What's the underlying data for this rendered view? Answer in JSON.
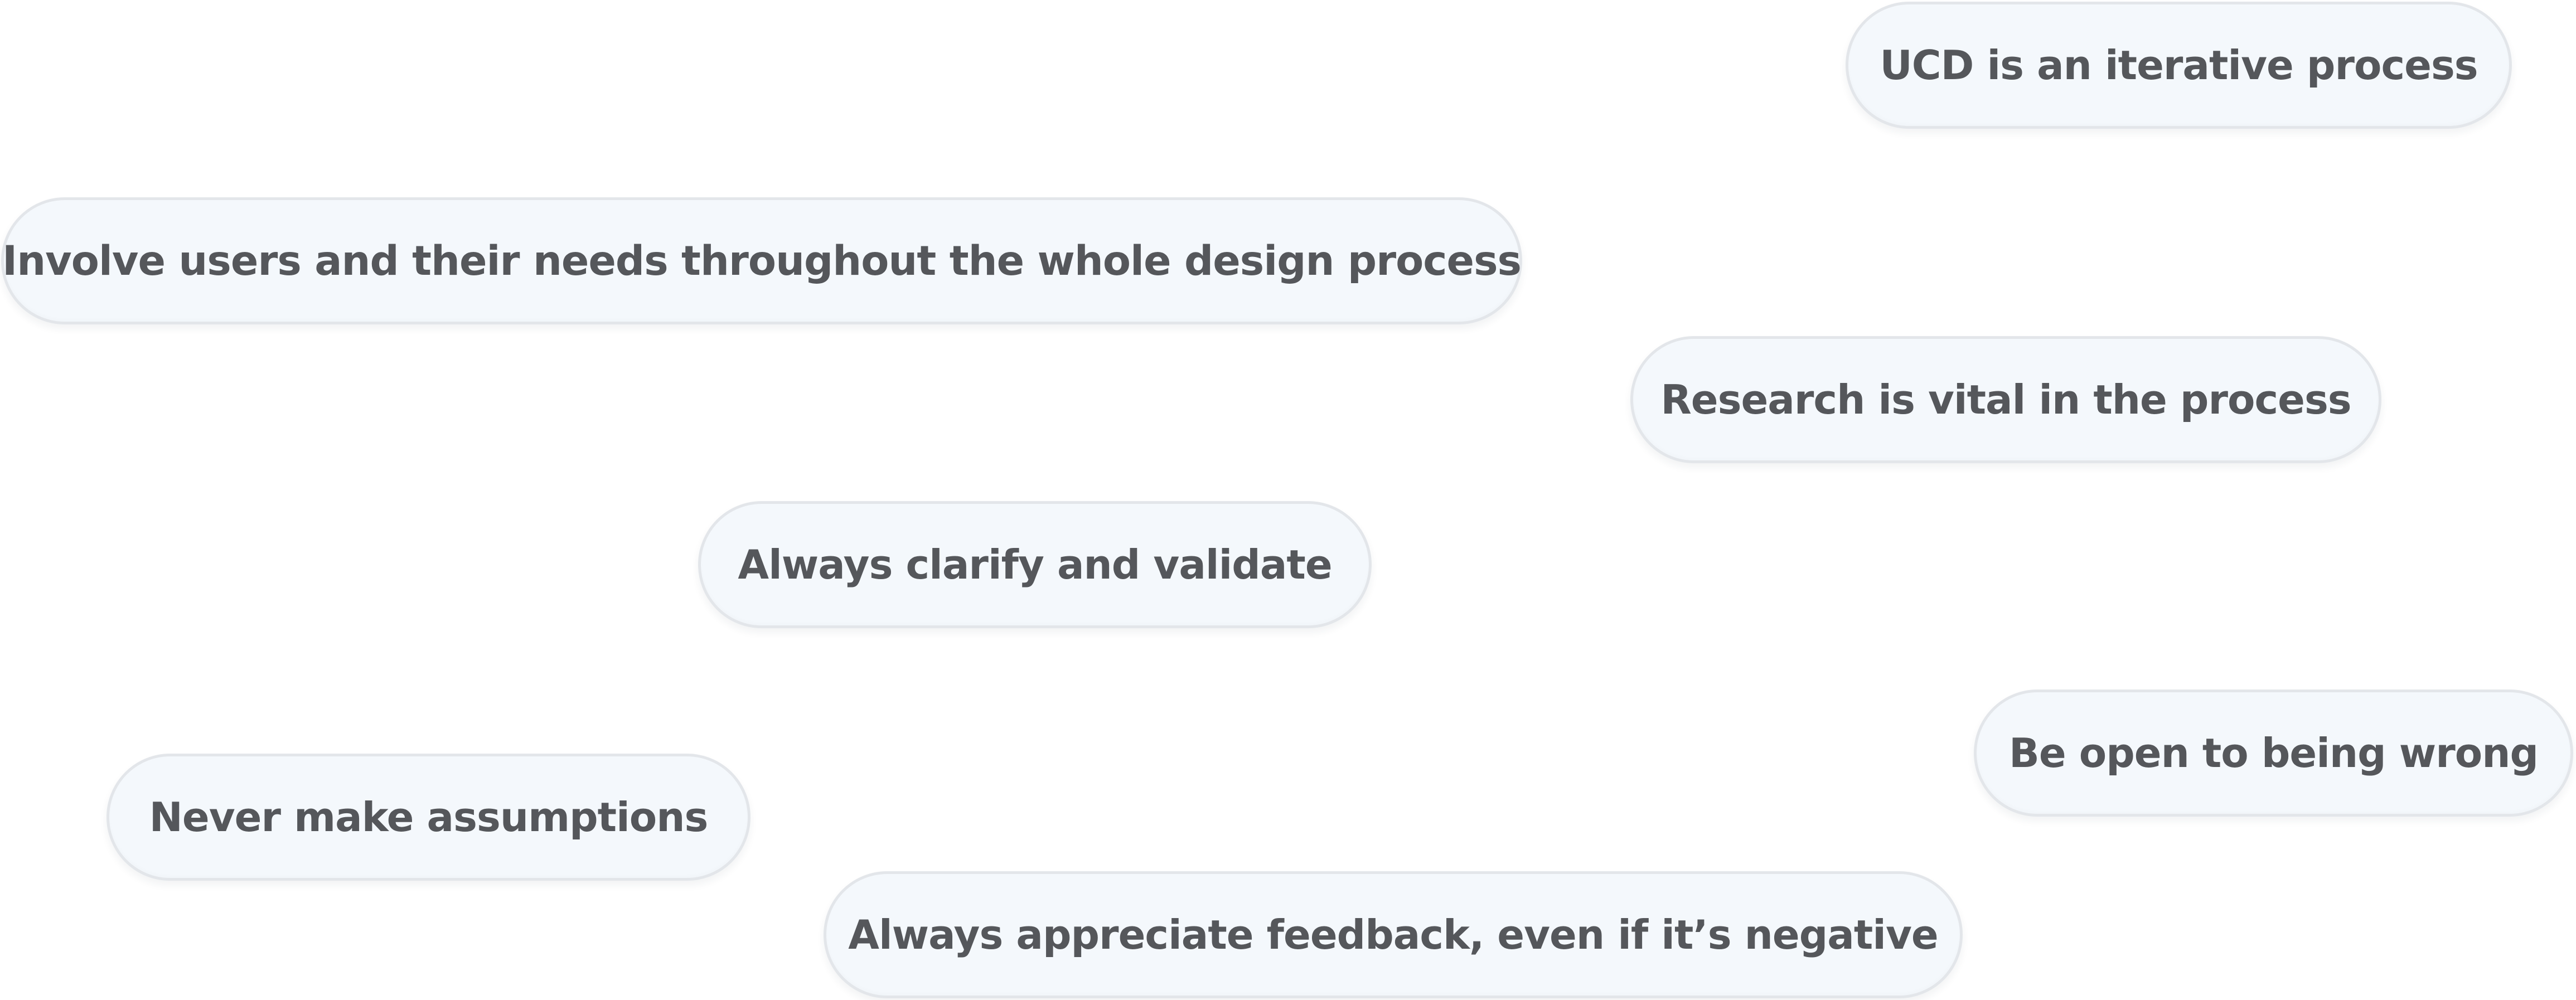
{
  "pills": [
    {
      "label": "UCD is an iterative process"
    },
    {
      "label": "Involve users and their needs throughout the whole design process"
    },
    {
      "label": "Research is vital in the process"
    },
    {
      "label": "Always clarify and validate"
    },
    {
      "label": "Be open to being wrong"
    },
    {
      "label": "Never make assumptions"
    },
    {
      "label": "Always appreciate feedback, even if it’s negative"
    }
  ],
  "colors": {
    "pill_background": "#f4f8fc",
    "pill_border": "#e3e6ea",
    "text": "#55575b",
    "page_background": "#ffffff"
  }
}
